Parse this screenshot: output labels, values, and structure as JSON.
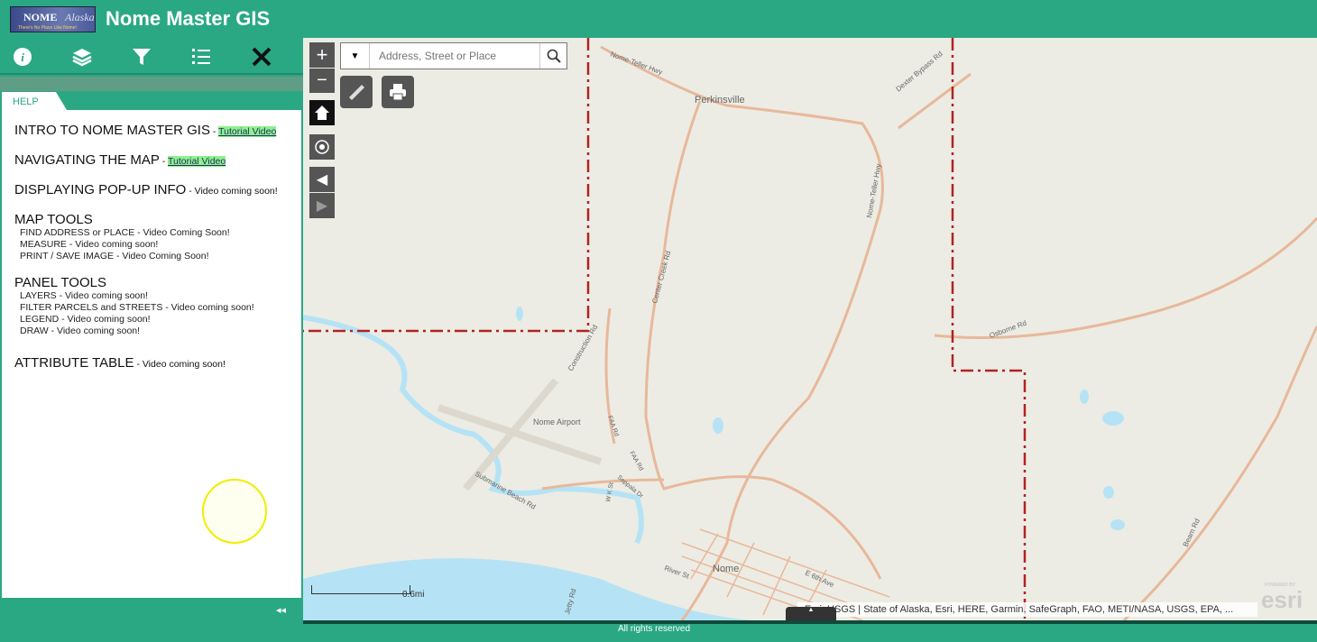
{
  "header": {
    "title": "Nome Master GIS",
    "logo_text": "NOME",
    "logo_script": "Alaska",
    "logo_tagline": "There's No Place Like Nome!"
  },
  "toolbar": {
    "icons": [
      "info-icon",
      "layers-icon",
      "filter-icon",
      "legend-icon",
      "draw-icon"
    ]
  },
  "panel": {
    "tab": "HELP",
    "sections": [
      {
        "heading": "INTRO TO NOME MASTER GIS",
        "sep": " - ",
        "link": "Tutorial Video"
      },
      {
        "heading": "NAVIGATING THE MAP",
        "sep": " - ",
        "link": "Tutorial Video"
      },
      {
        "heading": "DISPLAYING POP-UP INFO",
        "note": " - Video coming soon!"
      },
      {
        "heading": "MAP TOOLS",
        "items": [
          "FIND ADDRESS or PLACE - Video Coming Soon!",
          "MEASURE - Video coming soon!",
          "PRINT / SAVE IMAGE - Video Coming Soon!"
        ]
      },
      {
        "heading": "PANEL TOOLS",
        "items": [
          "LAYERS - Video coming soon!",
          "FILTER PARCELS and STREETS - Video coming soon!",
          "LEGEND - Video coming soon!",
          "DRAW - Video coming soon!"
        ]
      },
      {
        "heading": "ATTRIBUTE TABLE",
        "note": " - Video coming soon!"
      }
    ],
    "collapse": "◂◂"
  },
  "map": {
    "zoom_in": "+",
    "zoom_out": "−",
    "search_placeholder": "Address, Street or Place",
    "labels": {
      "perkinsville": "Perkinsville",
      "airport": "Nome Airport",
      "nome": "Nome",
      "nome_teller_1": "Nome-Teller Hwy",
      "nome_teller_2": "Nome-Teller Hwy",
      "dexter": "Dexter Bypass Rd",
      "center_creek": "Center Creek Rd",
      "construction": "Construction Rd",
      "osborne": "Osborne Rd",
      "faa1": "FAA Rd",
      "faa2": "FAA Rd",
      "seppala": "Seppala Dr",
      "submarine": "Submarine Beach Rd",
      "wk": "W K St",
      "river": "River St",
      "sixth": "E 6th Ave",
      "jetty": "Jetty Rd",
      "beam": "Beam Rd"
    },
    "scale": "0.6mi",
    "attribution": "Esri, USGS | State of Alaska, Esri, HERE, Garmin, SafeGraph, FAO, METI/NASA, USGS, EPA, ...",
    "esri": "esri",
    "esri_powered": "POWERED BY"
  },
  "footer": {
    "text": "All rights reserved"
  },
  "colors": {
    "brand": "#2aa884",
    "road": "#e8b89a",
    "boundary": "#b22222",
    "water": "#b5e3f5"
  }
}
